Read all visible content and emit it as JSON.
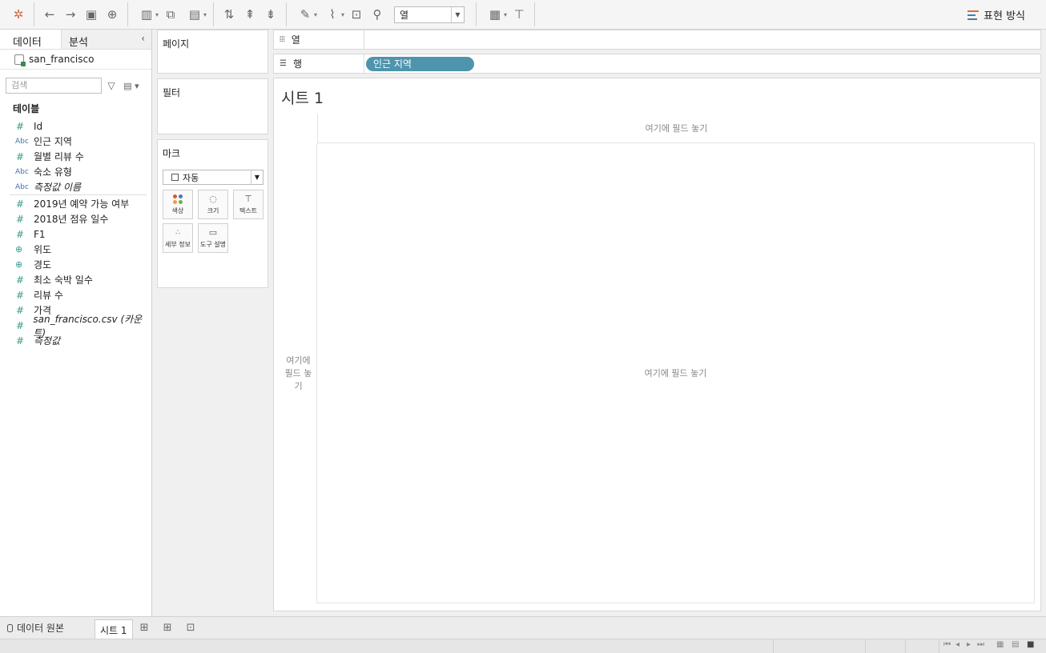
{
  "toolbar": {
    "icons": [
      "tableau-logo-icon",
      "undo-icon",
      "redo-icon",
      "save-icon",
      "new-datasource-icon",
      "new-worksheet-icon",
      "duplicate-icon",
      "clear-icon",
      "swap-icon",
      "sort-ascending-icon",
      "sort-descending-icon",
      "highlight-icon",
      "group-icon",
      "labels-icon",
      "pin-icon",
      "chart-fit-icon",
      "presentation-icon"
    ],
    "fit_select": "열",
    "show_me_label": "표현 방식"
  },
  "data_pane": {
    "tab_data": "데이터",
    "tab_analytics": "분석",
    "collapse_glyph": "‹",
    "datasource_name": "san_francisco",
    "search_placeholder": "검색",
    "tables_title": "테이블",
    "dimensions": [
      {
        "type": "#",
        "name": "Id",
        "italic": false
      },
      {
        "type": "Abc",
        "name": "인근 지역",
        "italic": false
      },
      {
        "type": "#",
        "name": "월별 리뷰 수",
        "italic": false
      },
      {
        "type": "Abc",
        "name": "숙소 유형",
        "italic": false
      },
      {
        "type": "Abc",
        "name": "측정값 이름",
        "italic": true
      }
    ],
    "measures": [
      {
        "type": "#",
        "name": "2019년 예약 가능 여부",
        "italic": false
      },
      {
        "type": "#",
        "name": "2018년 점유 일수",
        "italic": false
      },
      {
        "type": "#",
        "name": "F1",
        "italic": false
      },
      {
        "type": "⊕",
        "name": "위도",
        "italic": false
      },
      {
        "type": "⊕",
        "name": "경도",
        "italic": false
      },
      {
        "type": "#",
        "name": "최소 숙박 일수",
        "italic": false
      },
      {
        "type": "#",
        "name": "리뷰 수",
        "italic": false
      },
      {
        "type": "#",
        "name": "가격",
        "italic": false
      },
      {
        "type": "#",
        "name": "san_francisco.csv (카운트)",
        "italic": true
      },
      {
        "type": "#",
        "name": "측정값",
        "italic": true
      }
    ]
  },
  "cards": {
    "pages_title": "페이지",
    "filters_title": "필터",
    "marks_title": "마크",
    "mark_type": "자동",
    "mark_buttons": [
      {
        "label": "색상",
        "icon": "color-icon"
      },
      {
        "label": "크기",
        "icon": "size-icon"
      },
      {
        "label": "텍스트",
        "icon": "text-icon"
      },
      {
        "label": "세부 정보",
        "icon": "detail-icon"
      },
      {
        "label": "도구 설명",
        "icon": "tooltip-icon"
      }
    ]
  },
  "shelves": {
    "columns_label": "열",
    "rows_label": "행",
    "rows_pill": "인근 지역"
  },
  "view": {
    "sheet_title": "시트 1",
    "drop_top": "여기에 필드 놓기",
    "drop_left": "여기에 필드 놓기",
    "drop_main": "여기에 필드 놓기"
  },
  "tabs": {
    "data_source": "데이터 원본",
    "sheet": "시트 1"
  },
  "colors": {
    "pill": "#4e94ad",
    "mark_color_dots": [
      "#e0533b",
      "#4a7bb0",
      "#f0a030",
      "#6fb04a"
    ]
  }
}
